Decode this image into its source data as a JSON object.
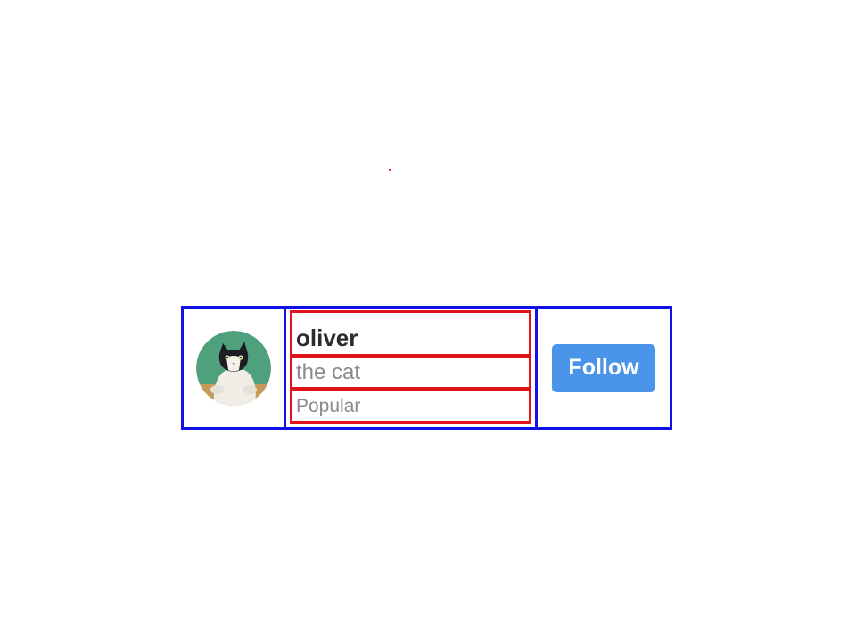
{
  "profile": {
    "name": "oliver",
    "description": "the cat",
    "tag": "Popular",
    "avatar_icon": "cat-photo-avatar"
  },
  "actions": {
    "follow_label": "Follow"
  },
  "colors": {
    "follow_button": "#4a94ea",
    "outer_boxes": "#1010e8",
    "inner_boxes": "#e0141a",
    "avatar_background": "#4fa07c"
  }
}
